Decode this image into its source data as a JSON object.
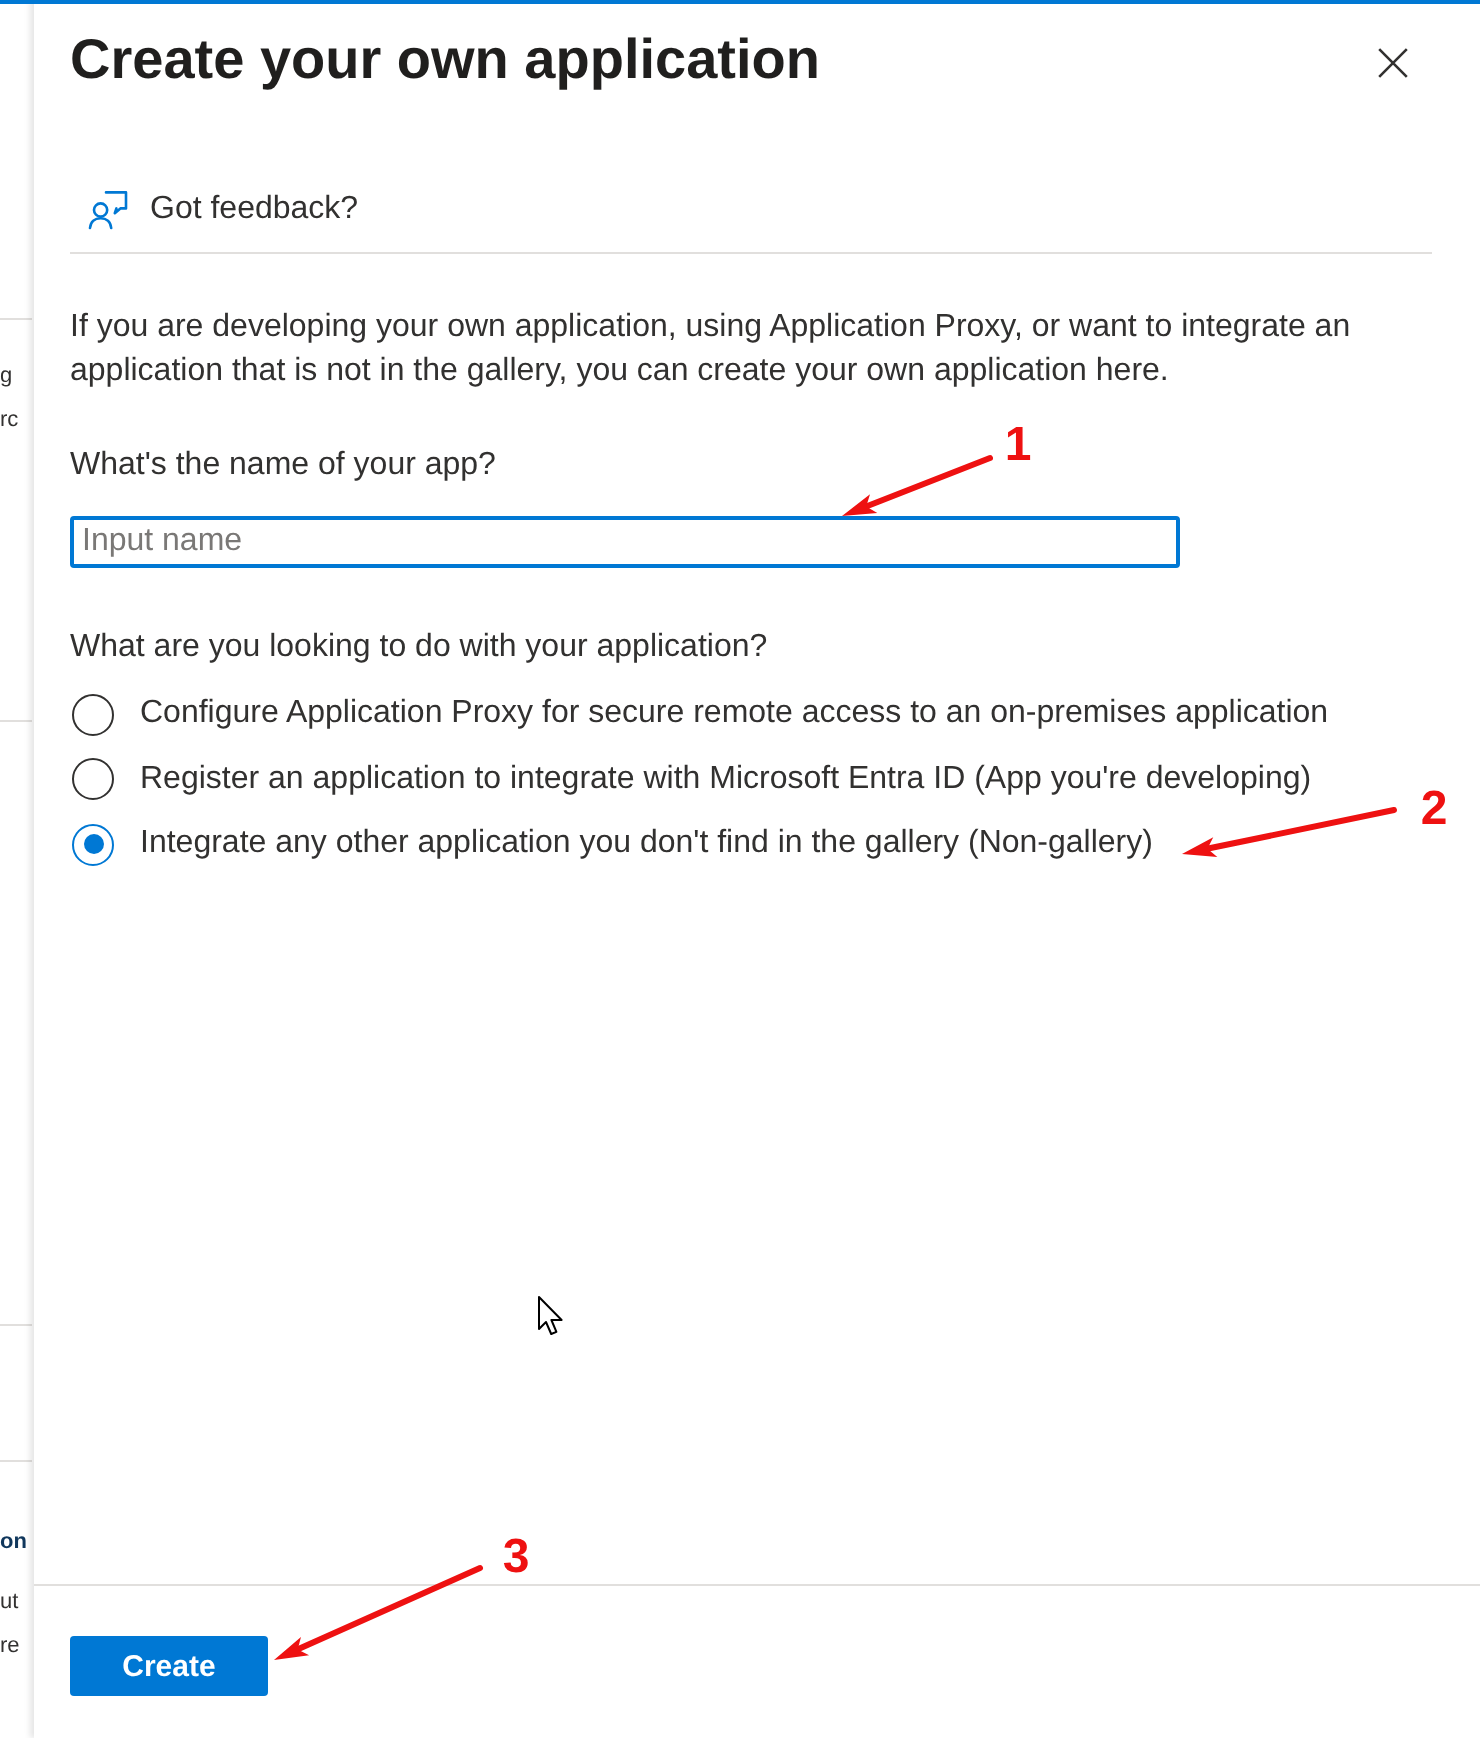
{
  "background_page": {
    "text_fragments": [
      {
        "text": "g",
        "kind": "body"
      },
      {
        "text": "rc",
        "kind": "body"
      },
      {
        "text": "on",
        "kind": "heading"
      },
      {
        "text": "ut",
        "kind": "body"
      },
      {
        "text": "re",
        "kind": "body"
      }
    ]
  },
  "dialog": {
    "title": "Create your own application",
    "feedback_link": "Got feedback?",
    "description": "If you are developing your own application, using Application Proxy, or want to integrate an application that is not in the gallery, you can create your own application here.",
    "name_field": {
      "label": "What's the name of your app?",
      "placeholder": "Input name"
    },
    "purpose": {
      "question": "What are you looking to do with your application?",
      "options": [
        {
          "label": "Configure Application Proxy for secure remote access to an on-premises application",
          "selected": false
        },
        {
          "label": "Register an application to integrate with Microsoft Entra ID (App you're developing)",
          "selected": false
        },
        {
          "label": "Integrate any other application you don't find in the gallery (Non-gallery)",
          "selected": true
        }
      ]
    },
    "buttons": [
      {
        "label": "Create",
        "kind": "primary"
      }
    ]
  },
  "annotations": [
    {
      "label": "1"
    },
    {
      "label": "2"
    },
    {
      "label": "3"
    }
  ]
}
